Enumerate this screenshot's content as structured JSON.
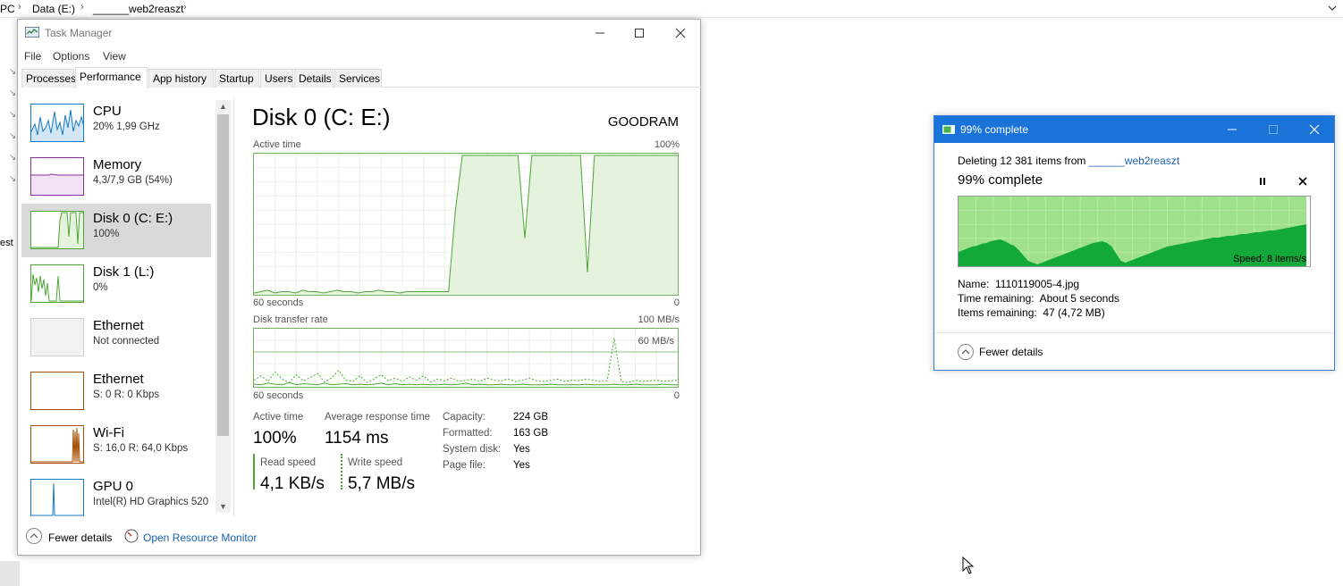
{
  "explorer": {
    "crumbs": [
      "PC",
      "Data (E:)",
      "______web2reaszt"
    ],
    "left_cut_text": "est"
  },
  "task_manager": {
    "title": "Task Manager",
    "menu": [
      "File",
      "Options",
      "View"
    ],
    "tabs": [
      "Processes",
      "Performance",
      "App history",
      "Startup",
      "Users",
      "Details",
      "Services"
    ],
    "active_tab": "Performance",
    "sidebar": [
      {
        "name": "CPU",
        "sub": "20%  1,99 GHz",
        "color": "#1479c4"
      },
      {
        "name": "Memory",
        "sub": "4,3/7,9 GB (54%)",
        "color": "#8b2fa0"
      },
      {
        "name": "Disk 0 (C: E:)",
        "sub": "100%",
        "color": "#4da635"
      },
      {
        "name": "Disk 1 (L:)",
        "sub": "0%",
        "color": "#4da635"
      },
      {
        "name": "Ethernet",
        "sub": "Not connected",
        "color": "#aaaaaa"
      },
      {
        "name": "Ethernet",
        "sub": "S: 0  R: 0 Kbps",
        "color": "#a74f01"
      },
      {
        "name": "Wi-Fi",
        "sub": "S: 16,0  R: 64,0 Kbps",
        "color": "#a74f01"
      },
      {
        "name": "GPU 0",
        "sub": "Intel(R) HD Graphics 520",
        "color": "#1479c4"
      }
    ],
    "main": {
      "title": "Disk 0 (C: E:)",
      "model": "GOODRAM",
      "active_time_label": "Active time",
      "active_time_max": "100%",
      "seconds_label": "60 seconds",
      "zero_label": "0",
      "transfer_label": "Disk transfer rate",
      "transfer_max": "100 MB/s",
      "transfer_mid": "60 MB/s",
      "active_time_series": [
        0,
        1,
        2,
        0,
        1,
        1,
        0,
        2,
        1,
        1,
        0,
        1,
        2,
        1,
        1,
        0,
        1,
        1,
        2,
        1,
        1,
        0,
        1,
        1,
        1,
        1,
        1,
        1,
        1,
        60,
        100,
        100,
        100,
        100,
        100,
        100,
        100,
        100,
        100,
        40,
        100,
        100,
        100,
        100,
        100,
        100,
        100,
        100,
        15,
        100,
        100,
        100,
        100,
        100,
        100,
        100,
        100,
        100,
        100,
        100,
        100,
        100
      ],
      "read_series": [
        3,
        2,
        5,
        3,
        2,
        6,
        2,
        4,
        3,
        2,
        5,
        2,
        3,
        4,
        2,
        3,
        2,
        3,
        5,
        2,
        4,
        2,
        3,
        2,
        3,
        2,
        2,
        3,
        2,
        3,
        5,
        2,
        3,
        2,
        2,
        3,
        2,
        2,
        3,
        2,
        2,
        2,
        3,
        2,
        2,
        2,
        2,
        3,
        2,
        2,
        2,
        3,
        2,
        2,
        3,
        2,
        2,
        2,
        3,
        2,
        2
      ],
      "write_series": [
        10,
        18,
        8,
        25,
        12,
        6,
        20,
        9,
        15,
        22,
        7,
        14,
        28,
        10,
        8,
        18,
        6,
        12,
        20,
        9,
        14,
        8,
        16,
        10,
        18,
        7,
        12,
        9,
        14,
        8,
        10,
        12,
        8,
        14,
        10,
        9,
        12,
        8,
        10,
        14,
        9,
        8,
        10,
        12,
        8,
        10,
        9,
        12,
        10,
        8,
        9,
        85,
        8,
        6,
        10,
        8,
        9,
        10,
        8,
        9,
        10
      ],
      "stats": {
        "active_time_label": "Active time",
        "active_time": "100%",
        "avg_response_label": "Average response time",
        "avg_response": "1154 ms",
        "read_label": "Read speed",
        "read": "4,1 KB/s",
        "write_label": "Write speed",
        "write": "5,7 MB/s"
      },
      "info": [
        {
          "k": "Capacity:",
          "v": "224 GB"
        },
        {
          "k": "Formatted:",
          "v": "163 GB"
        },
        {
          "k": "System disk:",
          "v": "Yes"
        },
        {
          "k": "Page file:",
          "v": "Yes"
        }
      ]
    },
    "footer": {
      "fewer_details": "Fewer details",
      "resource_monitor": "Open Resource Monitor"
    }
  },
  "progress_dialog": {
    "title": "99% complete",
    "deleting_prefix": "Deleting 12 381 items from ",
    "folder": "______web2reaszt",
    "heading": "99% complete",
    "progress": 0.99,
    "speed": "Speed: 8 items/s",
    "name_label": "Name:",
    "name_value": "1110119005-4.jpg",
    "time_label": "Time remaining:",
    "time_value": "About 5 seconds",
    "items_label": "Items remaining:",
    "items_value": "47 (4,72 MB)",
    "fewer_details": "Fewer details",
    "accent": "#1a73d9"
  }
}
